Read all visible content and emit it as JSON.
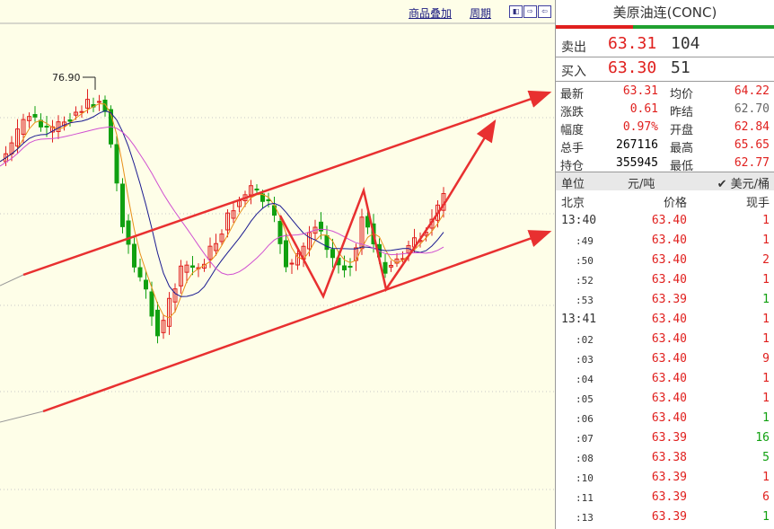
{
  "toolbar": {
    "overlay_label": "商品叠加",
    "period_label": "周期",
    "nav_buttons": [
      "◧",
      "⇨",
      "⇦"
    ]
  },
  "chart": {
    "high_marker": "76.90",
    "colors": {
      "up": "#e0201e",
      "down": "#10a010",
      "ma1": "#1a1a90",
      "ma2": "#e8901a",
      "ma3": "#d050d0",
      "arrow": "#e83030",
      "bg": "#fefee8"
    }
  },
  "quote": {
    "title": "美原油连(CONC)",
    "ask": {
      "label": "卖出",
      "price": "63.31",
      "volume": "104"
    },
    "bid": {
      "label": "买入",
      "price": "63.30",
      "volume": "51"
    },
    "stats": [
      {
        "l1": "最新",
        "v1": "63.31",
        "l2": "均价",
        "v2": "64.22"
      },
      {
        "l1": "涨跌",
        "v1": "0.61",
        "l2": "昨结",
        "v2": "62.70"
      },
      {
        "l1": "幅度",
        "v1": "0.97%",
        "l2": "开盘",
        "v2": "62.84"
      },
      {
        "l1": "总手",
        "v1": "267116",
        "l2": "最高",
        "v2": "65.65"
      },
      {
        "l1": "持仓",
        "v1": "355945",
        "l2": "最低",
        "v2": "62.77"
      }
    ],
    "unit": {
      "label": "单位",
      "per_ton": "元/吨",
      "per_barrel": "✔ 美元/桶"
    },
    "ticks_header": {
      "location": "北京",
      "price": "价格",
      "volume": "现手"
    },
    "ticks": [
      {
        "time": "13:40",
        "price": "63.40",
        "volume": "1",
        "dir": "up"
      },
      {
        "time": ":49",
        "price": "63.40",
        "volume": "1",
        "dir": "up"
      },
      {
        "time": ":50",
        "price": "63.40",
        "volume": "2",
        "dir": "up"
      },
      {
        "time": ":52",
        "price": "63.40",
        "volume": "1",
        "dir": "up"
      },
      {
        "time": ":53",
        "price": "63.39",
        "volume": "1",
        "dir": "down"
      },
      {
        "time": "13:41",
        "price": "63.40",
        "volume": "1",
        "dir": "up"
      },
      {
        "time": ":02",
        "price": "63.40",
        "volume": "1",
        "dir": "up"
      },
      {
        "time": ":03",
        "price": "63.40",
        "volume": "9",
        "dir": "up"
      },
      {
        "time": ":04",
        "price": "63.40",
        "volume": "1",
        "dir": "up"
      },
      {
        "time": ":05",
        "price": "63.40",
        "volume": "1",
        "dir": "up"
      },
      {
        "time": ":06",
        "price": "63.40",
        "volume": "1",
        "dir": "down"
      },
      {
        "time": ":07",
        "price": "63.39",
        "volume": "16",
        "dir": "down"
      },
      {
        "time": ":08",
        "price": "63.38",
        "volume": "5",
        "dir": "down"
      },
      {
        "time": ":10",
        "price": "63.39",
        "volume": "1",
        "dir": "up"
      },
      {
        "time": ":11",
        "price": "63.39",
        "volume": "6",
        "dir": "up"
      },
      {
        "time": ":13",
        "price": "63.39",
        "volume": "1",
        "dir": "down"
      }
    ]
  }
}
